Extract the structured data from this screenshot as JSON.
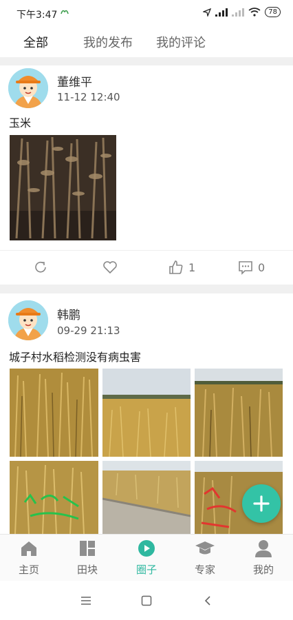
{
  "status": {
    "time": "下午3:47",
    "battery": "78"
  },
  "tabs": [
    {
      "label": "全部",
      "active": true
    },
    {
      "label": "我的发布"
    },
    {
      "label": "我的评论"
    }
  ],
  "posts": [
    {
      "username": "董维平",
      "time": "11-12 12:40",
      "text": "玉米",
      "likes": "1",
      "comments": "0"
    },
    {
      "username": "韩鹏",
      "time": "09-29 21:13",
      "text": "城子村水稻检测没有病虫害"
    }
  ],
  "fab": {
    "icon": "plus-icon"
  },
  "bottom_nav": [
    {
      "label": "主页",
      "icon": "home-icon"
    },
    {
      "label": "田块",
      "icon": "field-icon"
    },
    {
      "label": "圈子",
      "icon": "circle-play-icon",
      "active": true
    },
    {
      "label": "专家",
      "icon": "graduation-cap-icon"
    },
    {
      "label": "我的",
      "icon": "user-icon"
    }
  ],
  "colors": {
    "accent": "#33c3a6",
    "background_gap": "#f0f0f0"
  }
}
